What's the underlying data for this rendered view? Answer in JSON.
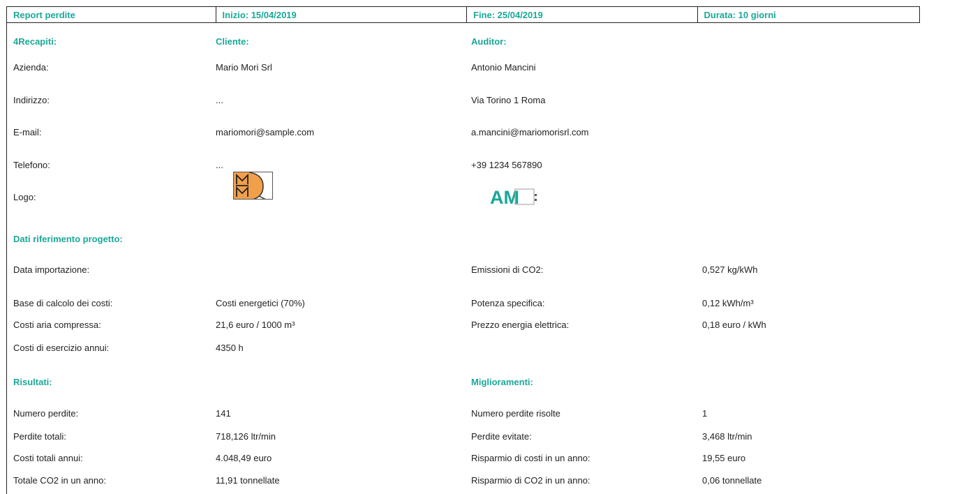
{
  "header": {
    "title": "Report perdite",
    "start": "Inizio: 15/04/2019",
    "end": "Fine: 25/04/2019",
    "duration": "Durata: 10 giorni"
  },
  "contacts": {
    "heading": "4Recapiti:",
    "client_heading": "Cliente:",
    "auditor_heading": "Auditor:",
    "rows": [
      {
        "label": "Azienda:",
        "client": "Mario Mori Srl",
        "auditor": "Antonio Mancini"
      },
      {
        "label": "Indirizzo:",
        "client": "...",
        "auditor": "Via Torino 1 Roma"
      },
      {
        "label": "E-mail:",
        "client": "mariomori@sample.com",
        "auditor": "a.mancini@mariomorisrl.com"
      },
      {
        "label": "Telefono:",
        "client": "...",
        "auditor": "+39 1234 567890"
      }
    ],
    "logo_label": "Logo:",
    "client_logo_text": "MM",
    "auditor_logo_text": "AM"
  },
  "project": {
    "heading": "Dati riferimento progetto:",
    "rows": [
      {
        "label": "Data importazione:",
        "value": "",
        "label2": "Emissioni di CO2:",
        "value2": "0,527 kg/kWh"
      },
      {
        "label": "Base di calcolo dei costi:",
        "value": "Costi energetici (70%)",
        "label2": "Potenza specifica:",
        "value2": "0,12 kWh/m³"
      },
      {
        "label": "Costi aria compressa:",
        "value": "21,6 euro / 1000 m³",
        "label2": "Prezzo energia elettrica:",
        "value2": "0,18 euro / kWh"
      },
      {
        "label": "Costi di esercizio annui:",
        "value": "4350 h",
        "label2": "",
        "value2": ""
      }
    ]
  },
  "results": {
    "heading": "Risultati:",
    "improvements_heading": "Miglioramenti:",
    "rows": [
      {
        "label": "Numero perdite:",
        "value": "141",
        "label2": "Numero perdite risolte",
        "value2": "1"
      },
      {
        "label": "Perdite totali:",
        "value": "718,126 ltr/min",
        "label2": "Perdite evitate:",
        "value2": "3,468 ltr/min"
      },
      {
        "label": "Costi totali annui:",
        "value": "4.048,49 euro",
        "label2": "Risparmio di costi in un anno:",
        "value2": "19,55 euro"
      },
      {
        "label": "Totale CO2 in un anno:",
        "value": "11,91 tonnellate",
        "label2": "Risparmio di CO2 in un anno:",
        "value2": "0,06 tonnellate"
      }
    ]
  },
  "colors": {
    "accent": "#1aa898",
    "logo_orange": "#f0a04b"
  }
}
